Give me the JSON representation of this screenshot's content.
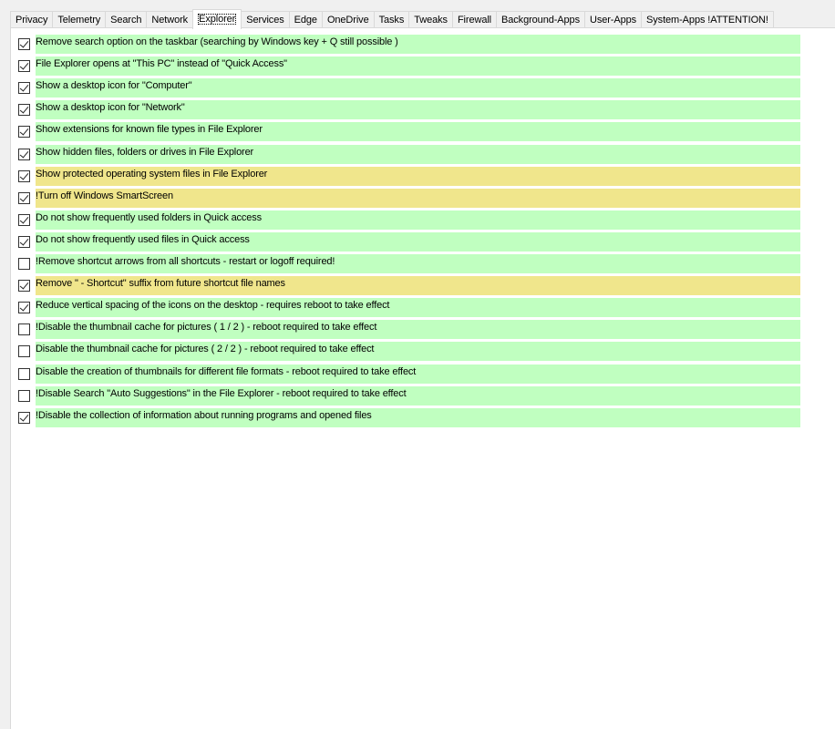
{
  "tabs": [
    {
      "label": "Privacy",
      "active": false
    },
    {
      "label": "Telemetry",
      "active": false
    },
    {
      "label": "Search",
      "active": false
    },
    {
      "label": "Network",
      "active": false
    },
    {
      "label": "Explorer",
      "active": true
    },
    {
      "label": "Services",
      "active": false
    },
    {
      "label": "Edge",
      "active": false
    },
    {
      "label": "OneDrive",
      "active": false
    },
    {
      "label": "Tasks",
      "active": false
    },
    {
      "label": "Tweaks",
      "active": false
    },
    {
      "label": "Firewall",
      "active": false
    },
    {
      "label": "Background-Apps",
      "active": false
    },
    {
      "label": "User-Apps",
      "active": false
    },
    {
      "label": "System-Apps !ATTENTION!",
      "active": false
    }
  ],
  "colors": {
    "recommended": "#c0ffc0",
    "caution": "#f0e68c"
  },
  "options": [
    {
      "label": "Remove search option on the taskbar (searching by Windows key + Q still possible )",
      "checked": true,
      "level": "recommended"
    },
    {
      "label": "File Explorer opens at \"This PC\" instead of \"Quick Access\"",
      "checked": true,
      "level": "recommended"
    },
    {
      "label": "Show a desktop icon for \"Computer\"",
      "checked": true,
      "level": "recommended"
    },
    {
      "label": "Show a desktop icon for \"Network\"",
      "checked": true,
      "level": "recommended"
    },
    {
      "label": "Show extensions for known file types in File Explorer",
      "checked": true,
      "level": "recommended"
    },
    {
      "label": "Show hidden files, folders or drives in File Explorer",
      "checked": true,
      "level": "recommended"
    },
    {
      "label": "Show protected operating system files in File Explorer",
      "checked": true,
      "level": "caution"
    },
    {
      "label": "!Turn off Windows SmartScreen",
      "checked": true,
      "level": "caution"
    },
    {
      "label": "Do not show frequently used folders in Quick access",
      "checked": true,
      "level": "recommended"
    },
    {
      "label": "Do not show frequently used files in Quick access",
      "checked": true,
      "level": "recommended"
    },
    {
      "label": "!Remove shortcut arrows from all shortcuts - restart or logoff required!",
      "checked": false,
      "level": "recommended"
    },
    {
      "label": "Remove \" - Shortcut\" suffix from future shortcut file names",
      "checked": true,
      "level": "caution"
    },
    {
      "label": "Reduce vertical spacing of the icons on the desktop - requires reboot to take effect",
      "checked": true,
      "level": "recommended"
    },
    {
      "label": "!Disable the thumbnail cache for pictures ( 1 / 2 ) - reboot required to take effect",
      "checked": false,
      "level": "recommended"
    },
    {
      "label": "Disable the thumbnail cache for pictures ( 2 / 2 ) - reboot required to take effect",
      "checked": false,
      "level": "recommended"
    },
    {
      "label": "Disable the creation of thumbnails for different file formats - reboot required to take effect",
      "checked": false,
      "level": "recommended"
    },
    {
      "label": "!Disable Search \"Auto Suggestions\" in the File Explorer - reboot required to take effect",
      "checked": false,
      "level": "recommended"
    },
    {
      "label": "!Disable the collection of information about running programs and opened files",
      "checked": true,
      "level": "recommended"
    }
  ]
}
